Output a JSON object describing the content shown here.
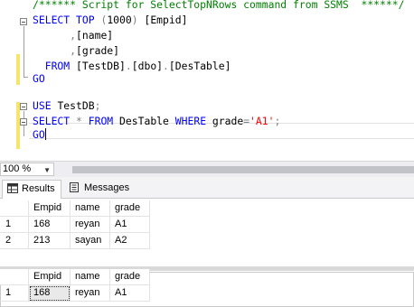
{
  "editor": {
    "lines": {
      "l1": {
        "comment": "/****** Script for SelectTopNRows command from SSMS  ******/"
      },
      "l2": {
        "kw1": "SELECT",
        "kw2": "TOP",
        "paren_open": "(",
        "num": "1000",
        "paren_close": ")",
        "col": "[Empid]"
      },
      "l3": {
        "comma": ",",
        "col": "[name]"
      },
      "l4": {
        "comma": ",",
        "col": "[grade]"
      },
      "l5": {
        "kw": "FROM",
        "db": "[TestDB]",
        "dot1": ".",
        "schema": "[dbo]",
        "dot2": ".",
        "table": "[DesTable]"
      },
      "l6": {
        "kw": "GO"
      },
      "l7": {
        "kw": "USE",
        "db": "TestDB",
        "semi": ";"
      },
      "l8": {
        "kw1": "SELECT",
        "star": "*",
        "kw2": "FROM",
        "table": "DesTable",
        "kw3": "WHERE",
        "col": "grade",
        "eq": "=",
        "str": "'A1'",
        "semi": ";"
      },
      "l9": {
        "kw": "GO"
      }
    }
  },
  "zoom": {
    "value": "100 %"
  },
  "tabs": {
    "results": "Results",
    "messages": "Messages"
  },
  "grid1": {
    "headers": [
      "Empid",
      "name",
      "grade"
    ],
    "rows": [
      {
        "num": "1",
        "empid": "168",
        "name": "reyan",
        "grade": "A1"
      },
      {
        "num": "2",
        "empid": "213",
        "name": "sayan",
        "grade": "A2"
      }
    ]
  },
  "grid2": {
    "headers": [
      "Empid",
      "name",
      "grade"
    ],
    "rows": [
      {
        "num": "1",
        "empid": "168",
        "name": "reyan",
        "grade": "A1"
      }
    ]
  },
  "colors": {
    "keyword": "#0000ff",
    "comment": "#008000",
    "string": "#ff0000",
    "operator": "#808080"
  }
}
